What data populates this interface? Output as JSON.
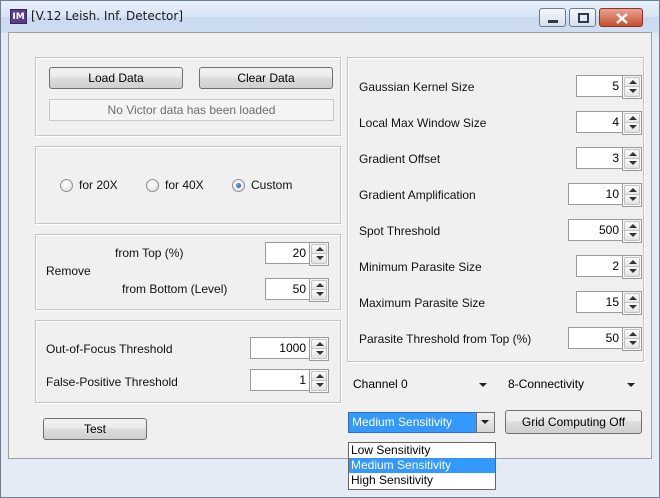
{
  "window": {
    "app_icon": "IM",
    "title": "[V.12 Leish. Inf. Detector]",
    "controls": [
      "minimize-icon",
      "maximize-icon",
      "close-icon"
    ]
  },
  "data_panel": {
    "load_label": "Load Data",
    "clear_label": "Clear Data",
    "status": "No Victor data has been loaded"
  },
  "magnification": {
    "options": [
      "for 20X",
      "for 40X",
      "Custom"
    ],
    "selected": "Custom"
  },
  "remove": {
    "label": "Remove",
    "top_label": "from Top (%)",
    "top_value": "20",
    "bottom_label": "from Bottom (Level)",
    "bottom_value": "50"
  },
  "thresholds": {
    "oof_label": "Out-of-Focus Threshold",
    "oof_value": "1000",
    "fp_label": "False-Positive Threshold",
    "fp_value": "1"
  },
  "test_label": "Test",
  "parameters": [
    {
      "label": "Gaussian Kernel Size",
      "value": "5"
    },
    {
      "label": "Local Max Window Size",
      "value": "4"
    },
    {
      "label": "Gradient Offset",
      "value": "3"
    },
    {
      "label": "Gradient Amplification",
      "value": "10"
    },
    {
      "label": "Spot Threshold",
      "value": "500"
    },
    {
      "label": "Minimum Parasite Size",
      "value": "2"
    },
    {
      "label": "Maximum Parasite Size",
      "value": "15"
    },
    {
      "label": "Parasite Threshold from Top (%)",
      "value": "50"
    }
  ],
  "channel": "Channel 0",
  "connectivity": "8-Connectivity",
  "sensitivity": {
    "value": "Medium Sensitivity",
    "options": [
      "Low Sensitivity",
      "Medium Sensitivity",
      "High Sensitivity"
    ],
    "selected_index": 1
  },
  "grid_label": "Grid Computing Off",
  "colors": {
    "selection": "#3399ff",
    "window_frame": "#e4ebf4",
    "client_background": "#f0f0f0",
    "close_button": "#c74e2f"
  }
}
